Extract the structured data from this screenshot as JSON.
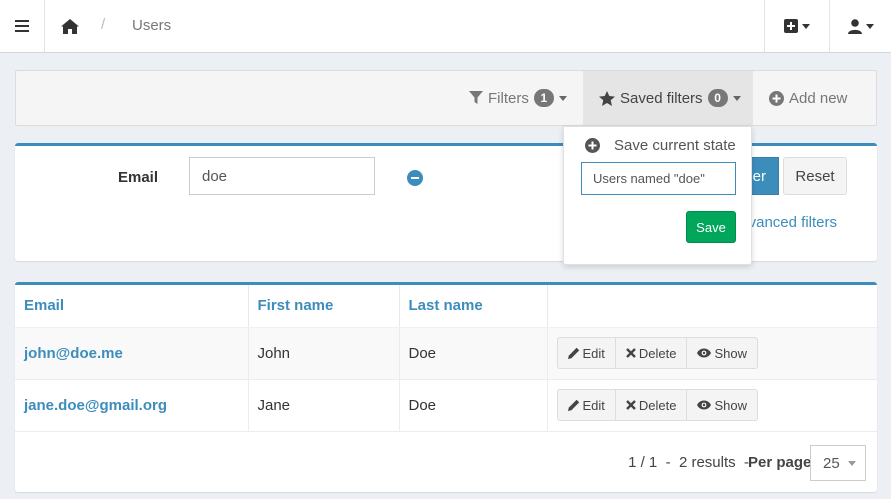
{
  "navbar": {
    "breadcrumb_separator": "/",
    "breadcrumb_current": "Users"
  },
  "actionbar": {
    "filters_label": "Filters",
    "filters_count": "1",
    "saved_filters_label": "Saved filters",
    "saved_filters_count": "0",
    "add_new_label": "Add new"
  },
  "filter": {
    "email_label": "Email",
    "email_value": "doe",
    "filter_button_label": "er",
    "reset_button_label": "Reset",
    "advanced_filters_label": "vanced filters"
  },
  "dropdown": {
    "save_current_state_label": "Save current state",
    "name_input_value": "Users named \"doe\"",
    "save_button_label": "Save"
  },
  "table": {
    "columns": [
      "Email",
      "First name",
      "Last name",
      ""
    ],
    "rows": [
      {
        "email": "john@doe.me",
        "first_name": "John",
        "last_name": "Doe"
      },
      {
        "email": "jane.doe@gmail.org",
        "first_name": "Jane",
        "last_name": "Doe"
      }
    ],
    "actions": {
      "edit": "Edit",
      "delete": "Delete",
      "show": "Show"
    }
  },
  "pagination": {
    "pages": "1 / 1",
    "dash": "-",
    "results": "2 results",
    "dash2": "-",
    "per_page_label": "Per page",
    "per_page_value": "25"
  },
  "colors": {
    "accent": "#3c8dbc",
    "success": "#00a65a"
  }
}
